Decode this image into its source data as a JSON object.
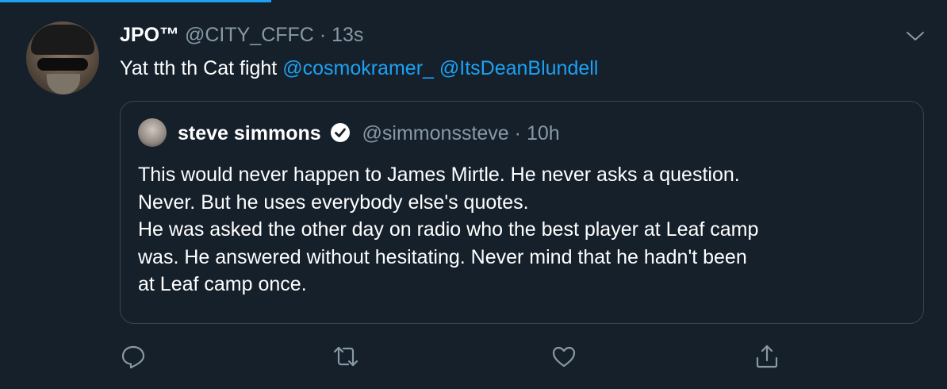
{
  "tweet": {
    "name": "JPO™",
    "handle": "@CITY_CFFC",
    "separator": "·",
    "time": "13s",
    "text_prefix": "Yat tth th Cat fight",
    "mentions": [
      "@cosmokramer_",
      "@ItsDeanBlundell"
    ]
  },
  "quote": {
    "name": "steve simmons",
    "verified": true,
    "handle": "@simmonssteve",
    "separator": "·",
    "time": "10h",
    "lines": [
      "This would never happen to James Mirtle. He never asks a question.",
      "Never. But he uses everybody else's quotes.",
      "He was asked the other day on radio who the best player at Leaf camp",
      "was. He answered without hesitating. Never mind that he hadn't been",
      "at Leaf camp once."
    ]
  },
  "actions": [
    "reply-icon",
    "retweet-icon",
    "like-icon",
    "share-icon"
  ],
  "colors": {
    "background": "#15202b",
    "accent": "#1da1f2",
    "secondary_text": "#8899a6",
    "border": "#38444d"
  }
}
